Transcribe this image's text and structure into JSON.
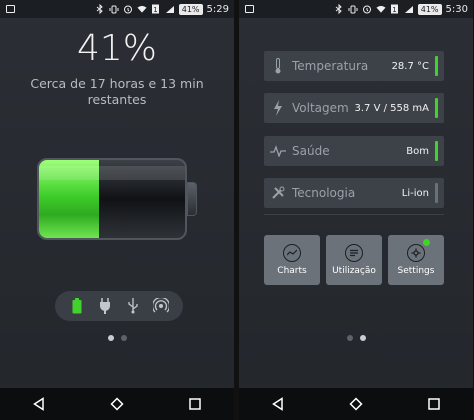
{
  "left": {
    "status": {
      "battery": "41%",
      "time": "5:29"
    },
    "percentage": "41%",
    "remaining": "Cerca de 17 horas e 13 min restantes",
    "battery_level": 0.41,
    "modes": [
      "battery-icon",
      "plug-icon",
      "usb-icon",
      "wireless-icon"
    ]
  },
  "right": {
    "status": {
      "battery": "41%",
      "time": "5:30"
    },
    "cards": [
      {
        "label": "Temperatura",
        "value": "28.7 °C",
        "icon": "thermometer-icon"
      },
      {
        "label": "Voltagem",
        "value": "3.7 V / 558 mA",
        "icon": "bolt-icon"
      },
      {
        "label": "Saúde",
        "value": "Bom",
        "icon": "pulse-icon"
      },
      {
        "label": "Tecnologia",
        "value": "Li-ion",
        "icon": "tools-icon"
      }
    ],
    "tiles": [
      {
        "label": "Charts",
        "icon": "chart-icon"
      },
      {
        "label": "Utilização",
        "icon": "list-icon"
      },
      {
        "label": "Settings",
        "icon": "gear-icon"
      }
    ]
  },
  "colors": {
    "accent": "#43d12e",
    "card": "#3d4248",
    "tile": "#6c7279"
  }
}
